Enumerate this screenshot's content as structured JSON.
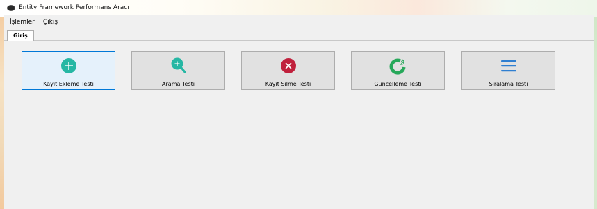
{
  "window": {
    "title": "Entity Framework Performans Aracı"
  },
  "menu": {
    "items": [
      {
        "label": "İşlemler"
      },
      {
        "label": "Çıkış"
      }
    ]
  },
  "tabs": [
    {
      "label": "Giriş",
      "selected": true
    }
  ],
  "buttons": [
    {
      "label": "Kayıt Ekleme Testi",
      "icon": "add-circle-icon",
      "color": "#26b7a4",
      "focused": true
    },
    {
      "label": "Arama Testi",
      "icon": "search-add-icon",
      "color": "#26b7a4",
      "focused": false
    },
    {
      "label": "Kayıt Silme Testi",
      "icon": "delete-circle-icon",
      "color": "#c0203c",
      "focused": false
    },
    {
      "label": "Güncelleme Testi",
      "icon": "update-icon",
      "color": "#27a85a",
      "focused": false
    },
    {
      "label": "Sıralama Testi",
      "icon": "list-icon",
      "color": "#2f7fd1",
      "focused": false
    }
  ]
}
